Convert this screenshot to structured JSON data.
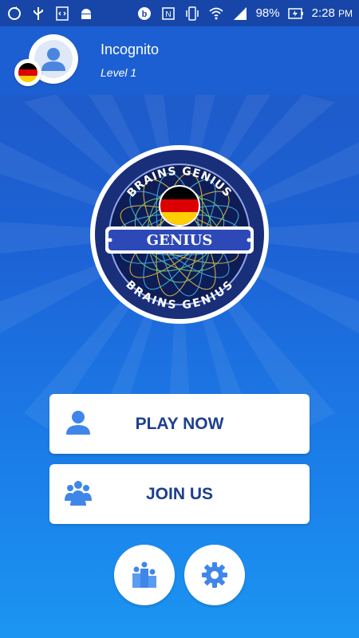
{
  "status_bar": {
    "battery": "98%",
    "time": "2:28",
    "ampm": "PM"
  },
  "user": {
    "name": "Incognito",
    "level": "Level 1",
    "flag_colors": [
      "#000000",
      "#dd0000",
      "#ffce00"
    ]
  },
  "logo": {
    "arc_top": "BRAINS GENIUS",
    "arc_bottom": "BRAINS GENIUS",
    "banner": "GENIUS"
  },
  "menu": {
    "play_label": "PLAY NOW",
    "join_label": "JOIN US"
  },
  "icons": {
    "play": "single-user-icon",
    "join": "group-users-icon",
    "leaderboard": "leaderboard-icon",
    "settings": "gear-icon"
  },
  "colors": {
    "button_text": "#1d3f8e",
    "icon_blue": "#3f86ea",
    "status_bar": "#1746a8",
    "header": "#1c5fd2"
  }
}
